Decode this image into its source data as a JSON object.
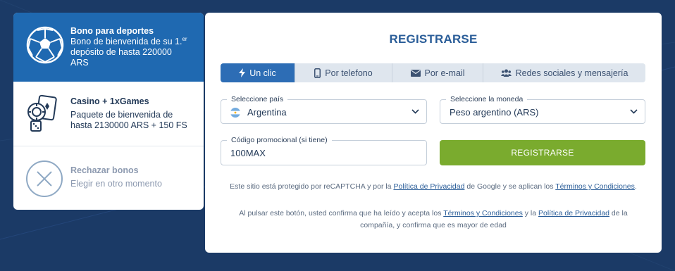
{
  "bonuses": {
    "sports": {
      "title": "Bono para deportes",
      "line1": "Bono de bienvenida de su 1.",
      "sup": "er",
      "line2": "depósito de hasta 220000",
      "line3": "ARS",
      "icon": "soccer-ball-icon"
    },
    "casino": {
      "title": "Casino + 1xGames",
      "line1": "Paquete de bienvenida de",
      "line2": "hasta 2130000 ARS + 150 FS",
      "icon": "casino-chips-icon"
    },
    "reject": {
      "title": "Rechazar bonos",
      "line1": "Elegir en otro momento",
      "icon": "close-circle-icon"
    }
  },
  "registration": {
    "title": "REGISTRARSE",
    "tabs": [
      {
        "label": "Un clic",
        "icon": "lightning-icon",
        "active": true
      },
      {
        "label": "Por telefono",
        "icon": "phone-icon",
        "active": false
      },
      {
        "label": "Por e-mail",
        "icon": "envelope-icon",
        "active": false
      },
      {
        "label": "Redes sociales y mensajería",
        "icon": "users-icon",
        "active": false
      }
    ],
    "country": {
      "label": "Seleccione país",
      "value": "Argentina"
    },
    "currency": {
      "label": "Seleccione la moneda",
      "value": "Peso argentino (ARS)"
    },
    "promo": {
      "label": "Código promocional (si tiene)",
      "value": "100MAX"
    },
    "submit_label": "REGISTRARSE",
    "recaptcha": {
      "pre": "Este sitio está protegido por reCAPTCHA y por la ",
      "privacy_link": "Política de Privacidad",
      "mid": " de Google y se aplican los ",
      "terms_link": "Términos y Condiciones",
      "post": "."
    },
    "consent": {
      "pre": "Al pulsar este botón, usted confirma que ha leído y acepta los ",
      "terms_link": "Términos y Condiciones",
      "mid": " y la ",
      "privacy_link": "Política de Privacidad",
      "post1": " de la",
      "line2": "compañía, y confirma que es mayor de edad"
    }
  },
  "colors": {
    "background": "#1b3a66",
    "accent": "#1f69b1",
    "button": "#7aab2e",
    "title": "#2a5d98"
  }
}
